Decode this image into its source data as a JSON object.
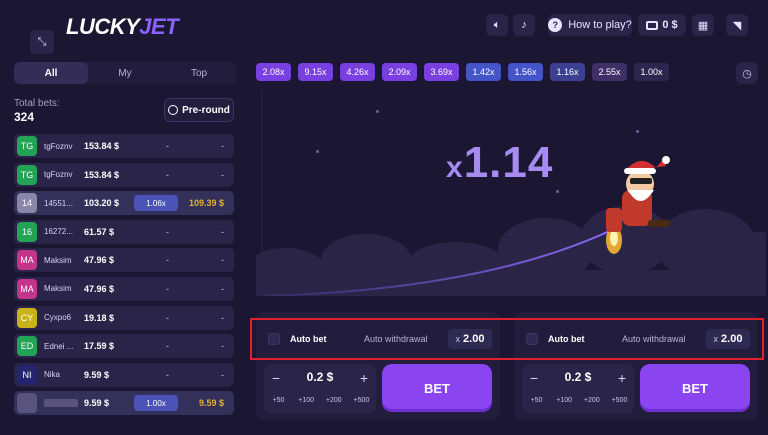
{
  "header": {
    "logo_lucky": "LUCKY",
    "logo_jet": "JET",
    "how_to_play": "How to play?",
    "balance": "0 $"
  },
  "tabs": [
    {
      "label": "All",
      "active": true
    },
    {
      "label": "My",
      "active": false
    },
    {
      "label": "Top",
      "active": false
    }
  ],
  "history": [
    {
      "value": "2.08x",
      "color": "#7a3fe0"
    },
    {
      "value": "9.15x",
      "color": "#7a3fe0"
    },
    {
      "value": "4.26x",
      "color": "#7a3fe0"
    },
    {
      "value": "2.09x",
      "color": "#7a3fe0"
    },
    {
      "value": "3.69x",
      "color": "#7a3fe0"
    },
    {
      "value": "1.42x",
      "color": "#4555c9"
    },
    {
      "value": "1.56x",
      "color": "#4555c9"
    },
    {
      "value": "1.16x",
      "color": "#3b4190"
    },
    {
      "value": "2.55x",
      "color": "#3e2f66"
    },
    {
      "value": "1.00x",
      "color": "#2d2750"
    }
  ],
  "total_bets": {
    "label": "Total bets:",
    "value": "324"
  },
  "preround_label": "Pre-round",
  "bets": [
    {
      "initials": "TG",
      "avatar_color": "#22a356",
      "name": "tgFoznv",
      "amount": "153.84 $",
      "mult": "-",
      "win": "-"
    },
    {
      "initials": "TG",
      "avatar_color": "#22a356",
      "name": "tgFoznv",
      "amount": "153.84 $",
      "mult": "-",
      "win": "-"
    },
    {
      "initials": "14",
      "avatar_color": "#8a86a8",
      "name": "14551...",
      "amount": "103.20 $",
      "mult": "1.06x",
      "win": "109.39 $"
    },
    {
      "initials": "16",
      "avatar_color": "#22a356",
      "name": "16272...",
      "amount": "61.57 $",
      "mult": "-",
      "win": "-"
    },
    {
      "initials": "MA",
      "avatar_color": "#c2358a",
      "name": "Maksim",
      "amount": "47.96 $",
      "mult": "-",
      "win": "-"
    },
    {
      "initials": "MA",
      "avatar_color": "#c2358a",
      "name": "Maksim",
      "amount": "47.96 $",
      "mult": "-",
      "win": "-"
    },
    {
      "initials": "CY",
      "avatar_color": "#c8b21a",
      "name": "Cyxpo6",
      "amount": "19.18 $",
      "mult": "-",
      "win": "-"
    },
    {
      "initials": "ED",
      "avatar_color": "#22a356",
      "name": "Ednei ...",
      "amount": "17.59 $",
      "mult": "-",
      "win": "-"
    },
    {
      "initials": "NI",
      "avatar_color": "#24256e",
      "name": "Nika",
      "amount": "9.59 $",
      "mult": "-",
      "win": "-"
    },
    {
      "initials": "",
      "avatar_color": "#59537e",
      "name": "",
      "amount": "9.59 $",
      "mult": "1.00x",
      "win": "9.59 $"
    }
  ],
  "game": {
    "multiplier_x": "x",
    "multiplier_value": "1.14"
  },
  "panels": [
    {
      "auto_bet": "Auto bet",
      "auto_withdrawal": "Auto withdrawal",
      "x_prefix": "x",
      "x_value": "2.00",
      "stake": "0.2 $",
      "quick": [
        "+50",
        "+100",
        "+200",
        "+500"
      ],
      "bet_label": "BET"
    },
    {
      "auto_bet": "Auto bet",
      "auto_withdrawal": "Auto withdrawal",
      "x_prefix": "x",
      "x_value": "2.00",
      "stake": "0.2 $",
      "quick": [
        "+50",
        "+100",
        "+200",
        "+500"
      ],
      "bet_label": "BET"
    }
  ]
}
